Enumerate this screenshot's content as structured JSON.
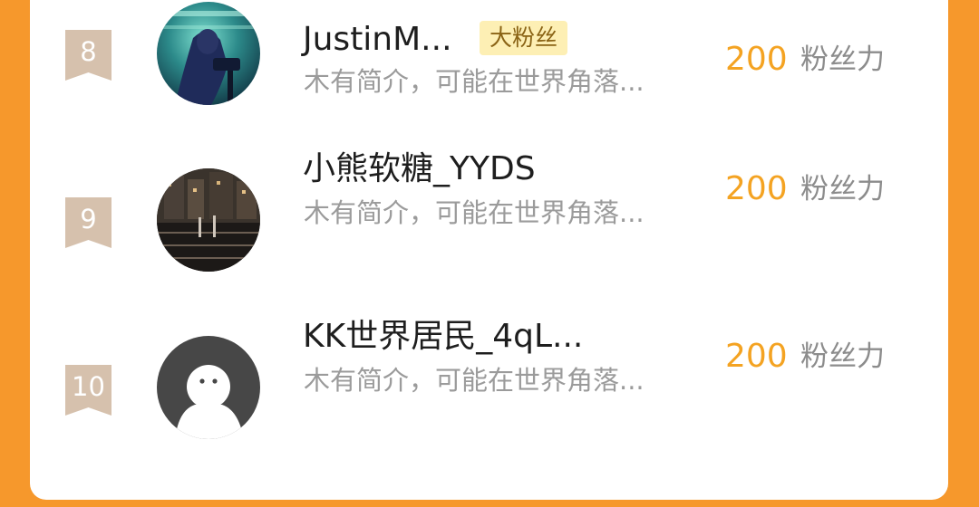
{
  "theme": {
    "background": "#f6982c",
    "card": "#ffffff",
    "rank_badge": "#d6c1ad",
    "score_color": "#f4a322",
    "fan_badge_bg": "#fdefb4"
  },
  "rows": [
    {
      "rank": "8",
      "name": "JustinM...",
      "badge": "大粉丝",
      "bio": "木有简介，可能在世界角落...",
      "score": "200",
      "score_unit": "粉丝力",
      "avatar": "photo-avatar-icon"
    },
    {
      "rank": "9",
      "name": "小熊软糖_YYDS",
      "bio": "木有简介，可能在世界角落...",
      "score": "200",
      "score_unit": "粉丝力",
      "avatar": "photo-avatar-icon"
    },
    {
      "rank": "10",
      "name": "KK世界居民_4qL...",
      "bio": "木有简介，可能在世界角落...",
      "score": "200",
      "score_unit": "粉丝力",
      "avatar": "default-avatar-icon"
    }
  ]
}
